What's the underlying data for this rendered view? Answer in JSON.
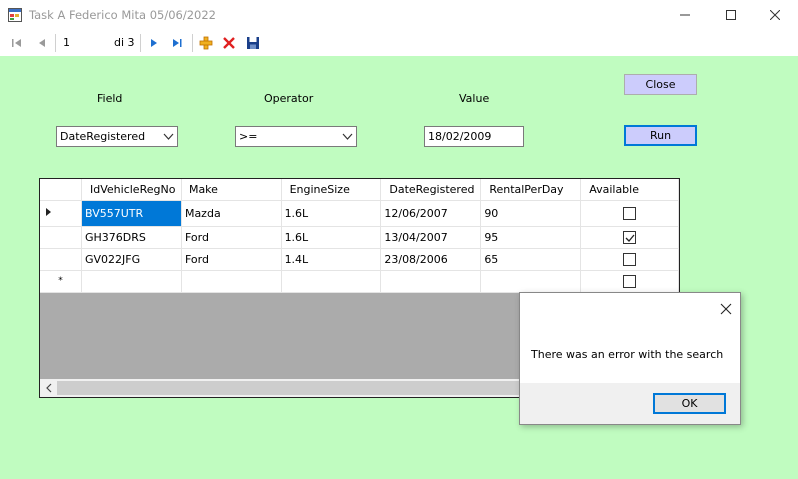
{
  "window": {
    "title": "Task A Federico Mita 05/06/2022"
  },
  "navigator": {
    "position": "1",
    "count_label": "di 3",
    "icons": [
      "move-first-icon",
      "move-previous-icon",
      "move-next-icon",
      "move-last-icon",
      "add-new-icon",
      "delete-icon",
      "save-icon"
    ]
  },
  "filter": {
    "field_label": "Field",
    "operator_label": "Operator",
    "value_label": "Value",
    "field_selected": "DateRegistered",
    "operator_selected": ">=",
    "value_text": "18/02/2009",
    "close_label": "Close",
    "run_label": "Run"
  },
  "grid": {
    "columns": [
      "IdVehicleRegNo",
      "Make",
      "EngineSize",
      "DateRegistered",
      "RentalPerDay",
      "Available"
    ],
    "rows": [
      {
        "reg": "BV557UTR",
        "make": "Mazda",
        "engine": "1.6L",
        "date": "12/06/2007",
        "rental": "90",
        "available": false
      },
      {
        "reg": "GH376DRS",
        "make": "Ford",
        "engine": "1.6L",
        "date": "13/04/2007",
        "rental": "95",
        "available": true
      },
      {
        "reg": "GV022JFG",
        "make": "Ford",
        "engine": "1.4L",
        "date": "23/08/2006",
        "rental": "65",
        "available": false
      }
    ],
    "new_row_marker": "*"
  },
  "dialog": {
    "message": "There was an error with the search",
    "ok_label": "OK"
  },
  "colors": {
    "form_background": "#c0fcc0",
    "button_background": "#ccccfc",
    "selection": "#0078d7",
    "grid_empty_area": "#ababab"
  }
}
